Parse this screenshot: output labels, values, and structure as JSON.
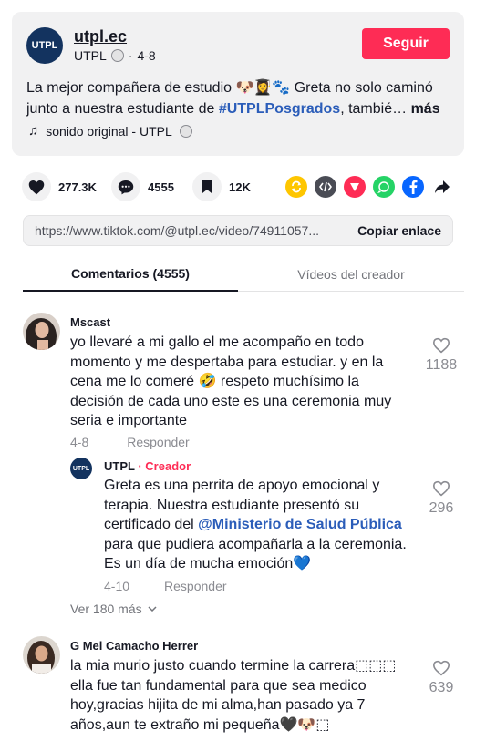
{
  "post": {
    "avatar_text": "UTPL",
    "account_name": "utpl.ec",
    "display_name": "UTPL",
    "date": "4-8",
    "follow_label": "Seguir",
    "description_lead": "La mejor compañera de estudio 🐶👩‍🎓🐾 Greta no solo caminó junto a nuestra estudiante de ",
    "description_tag": "#UTPLPosgrados",
    "description_tail": ", tambié…",
    "more_label": "más",
    "sound_label": "sonido original - UTPL"
  },
  "actions": {
    "likes": "277.3K",
    "comments": "4555",
    "saves": "12K"
  },
  "share_icons": [
    "repost-icon",
    "embed-icon",
    "send-icon",
    "whatsapp-icon",
    "facebook-icon",
    "share-arrow-icon"
  ],
  "link": {
    "url": "https://www.tiktok.com/@utpl.ec/video/74911057...",
    "copy_label": "Copiar enlace"
  },
  "tabs": {
    "comments": "Comentarios (4555)",
    "creator_videos": "Vídeos del creador"
  },
  "comments": [
    {
      "user": "Mscast",
      "text": "yo llevaré a mi gallo el me acompaño en todo momento y me despertaba para estudiar. y en la cena me lo comeré 🤣 respeto muchísimo la decisión de cada uno este es una ceremonia muy seria e importante",
      "date": "4-8",
      "reply_label": "Responder",
      "likes": "1188"
    },
    {
      "user": "G Mel Camacho Herrer",
      "text": "la mia murio justo cuando termine la carrera⬚⬚⬚ ella fue tan fundamental para que sea medico hoy,gracias hijita de mi alma,han pasado ya 7 años,aun te extraño mi pequeña🖤🐶⬚",
      "likes": "639"
    }
  ],
  "reply": {
    "user": "UTPL",
    "creator_tag": "· Creador",
    "text_1": "Greta es una perrita de apoyo emocional y terapia. Nuestra estudiante presentó su certificado del ",
    "mention": "@Ministerio de Salud Pública",
    "text_2": " para que pudiera acompañarla a la ceremonia. Es un día de mucha emoción💙",
    "date": "4-10",
    "reply_label": "Responder",
    "likes": "296"
  },
  "view_more": "Ver 180 más",
  "colors": {
    "accent": "#fe2c55",
    "brand": "#13335f",
    "link": "#2b5db9"
  }
}
